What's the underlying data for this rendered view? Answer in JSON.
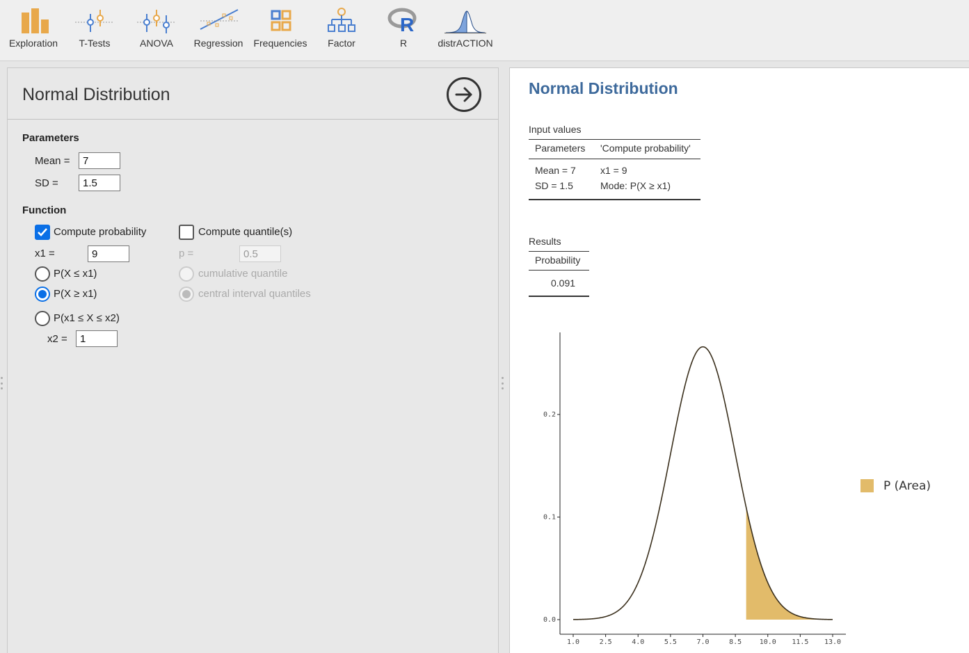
{
  "ribbon": {
    "items": [
      {
        "label": "Exploration",
        "icon": "exploration-icon"
      },
      {
        "label": "T-Tests",
        "icon": "t-tests-icon"
      },
      {
        "label": "ANOVA",
        "icon": "anova-icon"
      },
      {
        "label": "Regression",
        "icon": "regression-icon"
      },
      {
        "label": "Frequencies",
        "icon": "frequencies-icon"
      },
      {
        "label": "Factor",
        "icon": "factor-icon"
      },
      {
        "label": "R",
        "icon": "r-icon"
      },
      {
        "label": "distrACTION",
        "icon": "distraction-icon"
      }
    ]
  },
  "options": {
    "title": "Normal Distribution",
    "run_icon": "arrow-right-circle-icon",
    "parameters": {
      "heading": "Parameters",
      "mean_label": "Mean =",
      "mean_value": "7",
      "sd_label": "SD =",
      "sd_value": "1.5"
    },
    "function": {
      "heading": "Function",
      "compute_probability": {
        "label": "Compute probability",
        "checked": true
      },
      "x1_label": "x1 =",
      "x1_value": "9",
      "radio_le": {
        "label": "P(X ≤ x1)",
        "checked": false
      },
      "radio_ge": {
        "label": "P(X ≥ x1)",
        "checked": true
      },
      "radio_between": {
        "label": "P(x1 ≤ X ≤ x2)",
        "checked": false
      },
      "x2_label": "x2 =",
      "x2_value": "1",
      "compute_quantiles": {
        "label": "Compute quantile(s)",
        "checked": false
      },
      "p_label": "p =",
      "p_value": "0.5",
      "radio_cumulative": {
        "label": "cumulative quantile",
        "checked": false
      },
      "radio_central": {
        "label": "central interval quantiles",
        "checked": true
      }
    }
  },
  "results": {
    "title": "Normal Distribution",
    "input_table": {
      "title": "Input values",
      "headers": [
        "Parameters",
        "'Compute probability'"
      ],
      "rows": [
        [
          "Mean = 7",
          "x1 = 9"
        ],
        [
          "SD = 1.5",
          "Mode: P(X ≥ x1)"
        ]
      ]
    },
    "results_table": {
      "title": "Results",
      "header": "Probability",
      "value": "0.091"
    }
  },
  "chart_data": {
    "type": "area",
    "distribution": "normal",
    "mean": 7,
    "sd": 1.5,
    "shaded_from": 9,
    "xlim": [
      1.0,
      13.0
    ],
    "ylim": [
      0,
      0.28
    ],
    "x_ticks": [
      "1.0",
      "2.5",
      "4.0",
      "5.5",
      "7.0",
      "8.5",
      "10.0",
      "11.5",
      "13.0"
    ],
    "y_ticks": [
      "0.0",
      "0.1",
      "0.2"
    ],
    "legend": "P (Area)",
    "legend_position": "right",
    "colors": {
      "curve": "#3a2f1c",
      "area": "#e2bb6a"
    }
  },
  "colors": {
    "accent": "#0a6fe6",
    "results_title": "#3e6a9c",
    "icon_orange": "#e8a84a",
    "icon_blue": "#4a7fd0"
  }
}
